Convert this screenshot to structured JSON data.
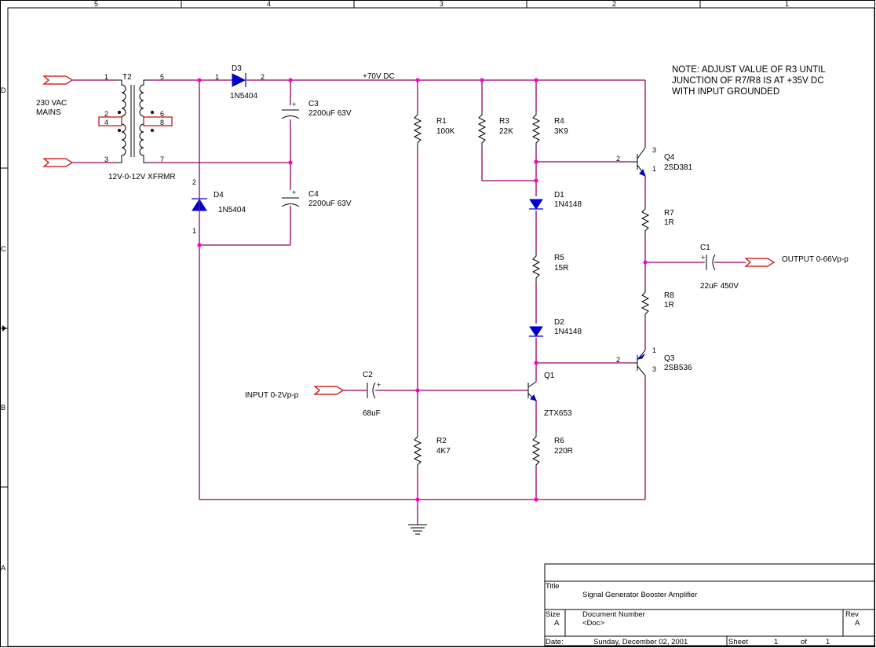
{
  "frame": {
    "columns": [
      "5",
      "4",
      "3",
      "2",
      "1"
    ],
    "rows": [
      "D",
      "C",
      "B",
      "A"
    ]
  },
  "note": [
    "NOTE:  ADJUST VALUE OF R3 UNTIL",
    "JUNCTION OF R7/R8 IS AT +35V DC",
    "WITH INPUT GROUNDED"
  ],
  "mains_label": [
    "230 VAC",
    "MAINS"
  ],
  "rail_label": "+70V DC",
  "input_label": "INPUT 0-2Vp-p",
  "output_label": "OUTPUT 0-66Vp-p",
  "transformer": {
    "ref": "T2",
    "value": "12V-0-12V XFRMR",
    "pins": [
      "1",
      "2",
      "3",
      "4",
      "5",
      "6",
      "7",
      "8"
    ]
  },
  "components": [
    {
      "ref": "D3",
      "value": "1N5404",
      "pins": [
        "1",
        "2"
      ]
    },
    {
      "ref": "D4",
      "value": "1N5404",
      "pins": [
        "2",
        "1"
      ]
    },
    {
      "ref": "C3",
      "value": "2200uF 63V"
    },
    {
      "ref": "C4",
      "value": "2200uF 63V"
    },
    {
      "ref": "R1",
      "value": "100K"
    },
    {
      "ref": "R2",
      "value": "4K7"
    },
    {
      "ref": "R3",
      "value": "22K"
    },
    {
      "ref": "R4",
      "value": "3K9"
    },
    {
      "ref": "D1",
      "value": "1N4148"
    },
    {
      "ref": "R5",
      "value": "15R"
    },
    {
      "ref": "D2",
      "value": "1N4148"
    },
    {
      "ref": "Q1",
      "value": "ZTX653"
    },
    {
      "ref": "R6",
      "value": "220R"
    },
    {
      "ref": "Q4",
      "value": "2SD381",
      "pins": [
        "3",
        "2",
        "1"
      ]
    },
    {
      "ref": "R7",
      "value": "1R"
    },
    {
      "ref": "C1",
      "value": "22uF 450V"
    },
    {
      "ref": "R8",
      "value": "1R"
    },
    {
      "ref": "Q3",
      "value": "2SB536",
      "pins": [
        "1",
        "2",
        "3"
      ]
    },
    {
      "ref": "C2",
      "value": "68uF"
    }
  ],
  "title_block": {
    "title_label": "Title",
    "title": "Signal Generator Booster Amplifier",
    "size_label": "Size",
    "size": "A",
    "docnum_label": "Document Number",
    "docnum": "<Doc>",
    "rev_label": "Rev",
    "rev": "A",
    "date_label": "Date:",
    "date": "Sunday, December 02, 2001",
    "sheet_label": "Sheet",
    "sheet": "1",
    "of_label": "of",
    "of": "1"
  },
  "colors": {
    "wire": "#990066",
    "junction": "#ff00cc",
    "component": "#000000",
    "semiconductor": "#0000cc",
    "port": "#cc0000"
  }
}
